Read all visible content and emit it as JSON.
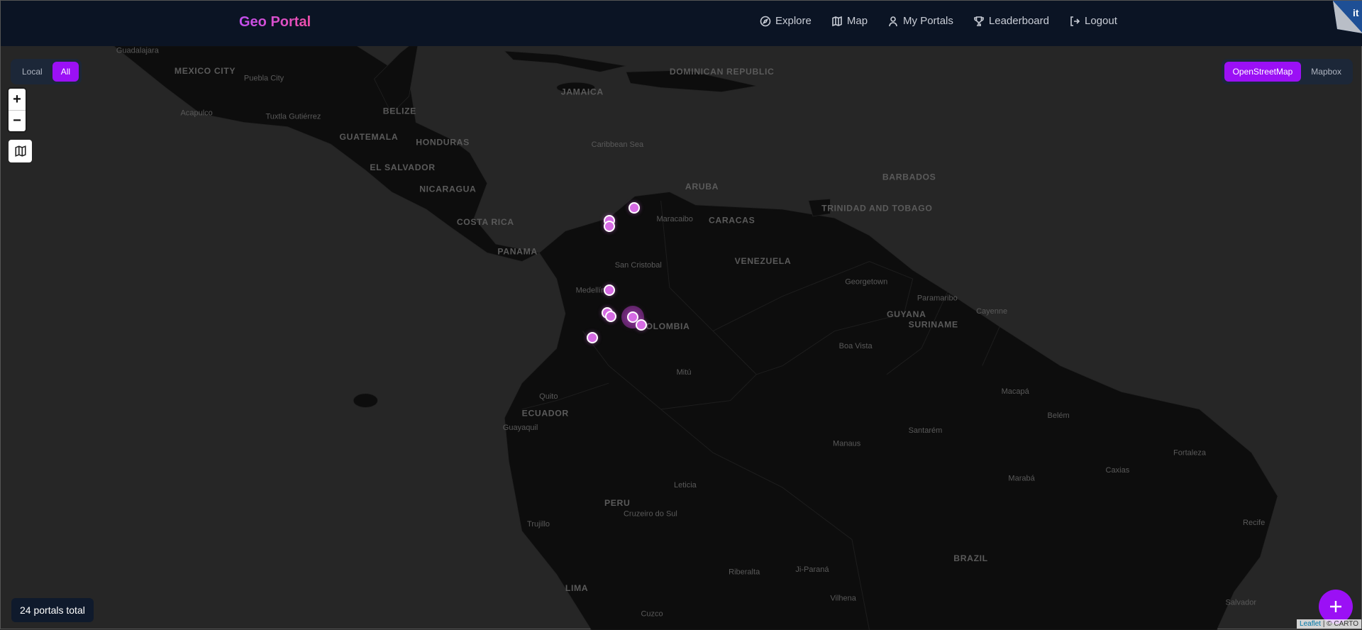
{
  "header": {
    "brand": "Geo Portal",
    "nav": [
      {
        "label": "Explore",
        "icon": "compass-icon"
      },
      {
        "label": "Map",
        "icon": "map-icon"
      },
      {
        "label": "My Portals",
        "icon": "user-icon"
      },
      {
        "label": "Leaderboard",
        "icon": "trophy-icon"
      },
      {
        "label": "Logout",
        "icon": "logout-icon"
      }
    ]
  },
  "scope_toggle": {
    "options": [
      "Local",
      "All"
    ],
    "selected": "All"
  },
  "basemap_toggle": {
    "options": [
      "OpenStreetMap",
      "Mapbox"
    ],
    "selected": "OpenStreetMap"
  },
  "zoom_controls": {
    "in": "+",
    "out": "−"
  },
  "status": {
    "portals_total": "24 portals total"
  },
  "attribution": {
    "leaflet": "Leaflet",
    "carto": "| © CARTO"
  },
  "colors": {
    "accent": "#9b10f5",
    "marker": "#d66be4",
    "header_bg": "#0b1424"
  },
  "map_labels": {
    "mexico_city": "MEXICO CITY",
    "puebla": "Puebla City",
    "guadalajara": "Guadalajara",
    "acapulco": "Acapulco",
    "tuxtla": "Tuxtla Gutiérrez",
    "belize": "BELIZE",
    "guatemala": "GUATEMALA",
    "honduras": "HONDURAS",
    "el_salvador": "EL SALVADOR",
    "nicaragua": "NICARAGUA",
    "costa_rica": "COSTA RICA",
    "panama": "PANAMA",
    "jamaica": "JAMAICA",
    "dominican": "DOMINICAN REPUBLIC",
    "caribbean": "Caribbean Sea",
    "aruba": "ARUBA",
    "barbados": "BARBADOS",
    "trinidad": "TRINIDAD AND TOBAGO",
    "maracaibo": "Maracaibo",
    "caracas": "CARACAS",
    "venezuela": "VENEZUELA",
    "san_cristobal": "San Cristobal",
    "medellin": "Medellín",
    "colombia": "COLOMBIA",
    "guyana": "GUYANA",
    "suriname": "SURINAME",
    "georgetown": "Georgetown",
    "paramaribo": "Paramaribo",
    "cayenne": "Cayenne",
    "boa_vista": "Boa Vista",
    "ecuador": "ECUADOR",
    "quito": "Quito",
    "guayaquil": "Guayaquil",
    "mitu": "Mitú",
    "macapa": "Macapá",
    "belem": "Belém",
    "santarem": "Santarém",
    "manaus": "Manaus",
    "fortaleza": "Fortaleza",
    "leticia": "Leticia",
    "peru": "PERU",
    "maraba": "Marabá",
    "caxias": "Caxias",
    "cruzeiro": "Cruzeiro do Sul",
    "trujillo": "Trujillo",
    "recife": "Recife",
    "brazil": "BRAZIL",
    "lima": "LIMA",
    "riberalta": "Riberalta",
    "jiparana": "Ji-Paraná",
    "vilhena": "Vilhena",
    "salvador": "Salvador",
    "cuzco": "Cuzco"
  }
}
